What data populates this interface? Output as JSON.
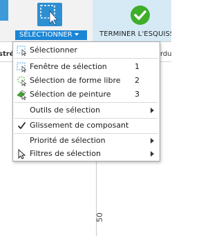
{
  "toolbar": {
    "select_button_label": "SÉLECTIONNER",
    "finish_button_label": "TERMINER L'ESQUISSE",
    "finish_color": "#3fae2a",
    "accent_color": "#1c86d6"
  },
  "canvas": {
    "column_left_label": "stré",
    "column_right_label": "rdu",
    "ruler_value": "50"
  },
  "menu": {
    "items": [
      {
        "label": "Sélectionner",
        "shortcut": "",
        "icon": "select-box-icon"
      },
      {
        "label": "Fenêtre de sélection",
        "shortcut": "1",
        "icon": "window-select-icon"
      },
      {
        "label": "Sélection de forme libre",
        "shortcut": "2",
        "icon": "freeform-select-icon"
      },
      {
        "label": "Sélection de peinture",
        "shortcut": "3",
        "icon": "paint-select-icon"
      },
      {
        "label": "Outils de sélection",
        "shortcut": "",
        "icon": "",
        "submenu": true
      },
      {
        "label": "Glissement de composant",
        "shortcut": "",
        "icon": "checkmark-icon",
        "checked": true
      },
      {
        "label": "Priorité de sélection",
        "shortcut": "",
        "icon": "",
        "submenu": true
      },
      {
        "label": "Filtres de sélection",
        "shortcut": "",
        "icon": "cursor-arrow-icon",
        "submenu": true
      }
    ]
  }
}
